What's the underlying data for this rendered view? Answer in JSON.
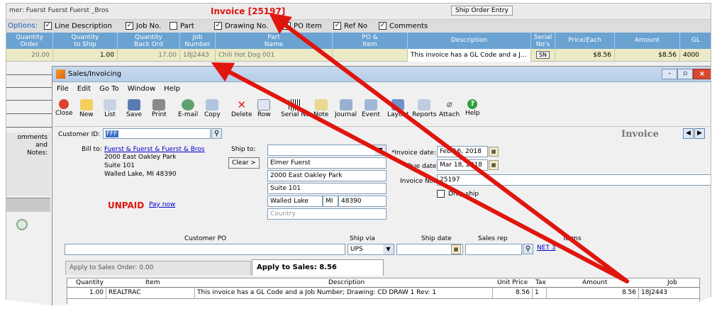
{
  "topbar": {
    "customer_fragment": "mer: Fuerst  Fuerst  Fuerst _Bros",
    "invoice_title": "Invoice [25197]",
    "ship_order_btn": "Ship Order Entry"
  },
  "options": {
    "label": "Options:",
    "items": [
      {
        "label": "Line Description",
        "checked": "✓"
      },
      {
        "label": "Job No.",
        "checked": "✓"
      },
      {
        "label": "Part",
        "checked": ""
      },
      {
        "label": "Drawing No.",
        "checked": "✓"
      },
      {
        "label": "PO Item",
        "checked": "✓"
      },
      {
        "label": "Ref No",
        "checked": "✓"
      },
      {
        "label": "Comments",
        "checked": "✓"
      }
    ]
  },
  "grid": {
    "headers": [
      "Quantity\nOrder",
      "Quantity\nto Ship",
      "Quantity\nBack Ord",
      "Job\nNumber",
      "Part\nName",
      "PO &\nItem",
      "Description",
      "Serial\nNo's",
      "Price/Each",
      "Amount",
      "GL"
    ],
    "row": [
      "20.00",
      "1.00",
      "17.00",
      "18J2443",
      "Chili Hot Dog 001",
      "",
      "This invoice has a GL Code and a J...",
      "SN",
      "",
      "$8.56",
      "$8.56",
      "4000"
    ]
  },
  "leftpanel": {
    "comments": "omments",
    "and": "and",
    "notes": "Notes:"
  },
  "window": {
    "title": "Sales/Invoicing",
    "menu": [
      "File",
      "Edit",
      "Go To",
      "Window",
      "Help"
    ],
    "toolbar": [
      "Close",
      "New",
      "List",
      "Save",
      "Print",
      "E-mail",
      "Copy",
      "Delete",
      "Row",
      "Serial No",
      "Note",
      "Journal",
      "Event",
      "Layout",
      "Reports",
      "Attach",
      "Help"
    ],
    "customer_id_label": "Customer ID:",
    "customer_id": "FFF",
    "heading": "Invoice",
    "billto_label": "Bill to:",
    "billto_name": "Fuerst & Fuerst & Fuerst & Bros",
    "billto_lines": [
      "2000 East Oakley Park",
      "Suite 101",
      "Walled Lake, MI 48390"
    ],
    "shipto_label": "Ship to:",
    "clear_btn": "Clear >",
    "shipto_lines": [
      "Elmer Fuerst",
      "2000 East Oakley Park",
      "Suite 101"
    ],
    "ship_city": "Walled Lake",
    "ship_state": "MI",
    "ship_zip": "48390",
    "country_placeholder": "Country",
    "status": "UNPAID",
    "paynow": "Pay now",
    "invoice_date_label": "*Invoice date:",
    "invoice_date": "Feb 16, 2018",
    "due_date_label": "Due date:",
    "due_date": "Mar 18, 2018",
    "invoice_no_label": "Invoice No.:",
    "invoice_no": "25197",
    "dropship_label": "Drop ship",
    "customer_po_label": "Customer PO",
    "ship_via_label": "Ship via",
    "ship_via": "UPS",
    "ship_date_label": "Ship date",
    "sales_rep_label": "Sales rep",
    "terms_label": "Terms",
    "terms_value": "NET 3",
    "tab_order": "Apply to Sales Order: 0.00",
    "tab_sales": "Apply to Sales: 8.56",
    "lines_headers": [
      "Quantity",
      "Item",
      "Description",
      "Unit Price",
      "Tax",
      "Amount",
      "Job"
    ],
    "lines_row": [
      "1.00",
      "REALTRAC",
      "This invoice has a GL Code and a Job Number; Drawing: CD DRAW 1 Rev: 1",
      "8.56",
      "1",
      "8.56",
      "18J2443"
    ]
  },
  "colors": {
    "accent_red": "#e0160e",
    "grid_header": "#6aa2d2",
    "unpaid": "#e0160e"
  }
}
